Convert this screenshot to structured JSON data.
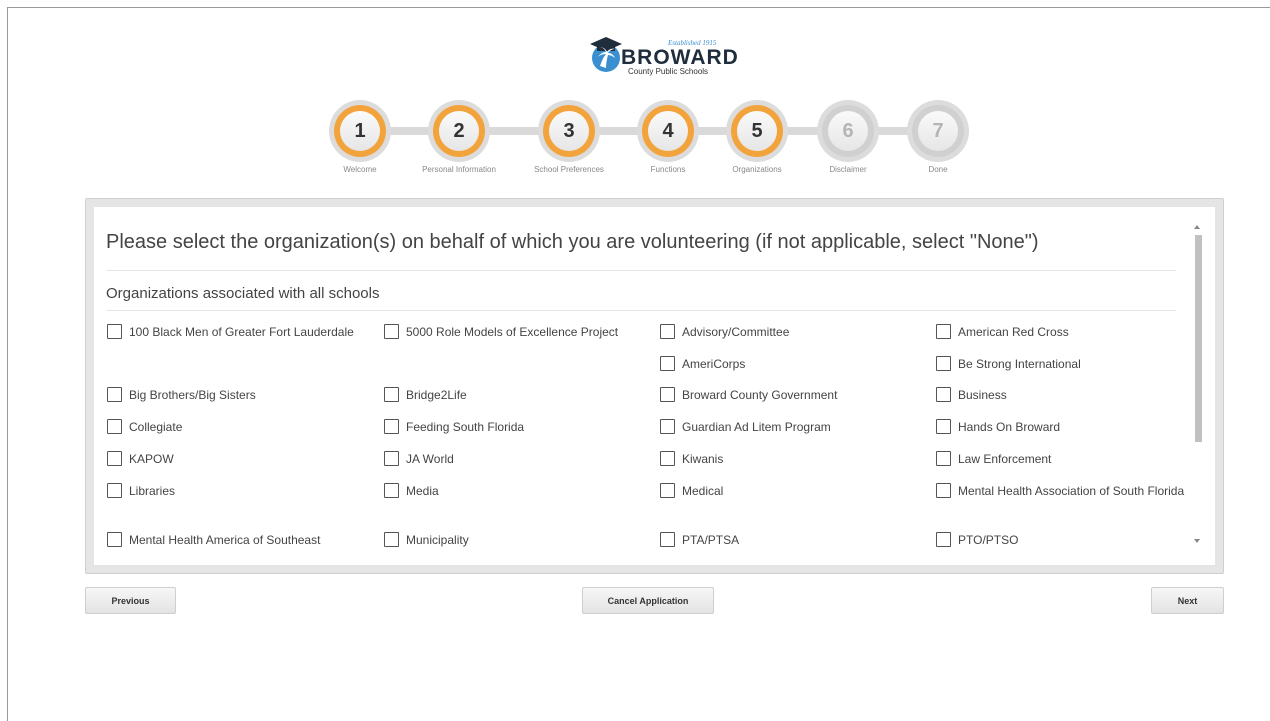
{
  "logo": {
    "established": "Established 1915",
    "name": "BROWARD",
    "subtitle": "County Public Schools"
  },
  "steps": [
    {
      "number": "1",
      "label": "Welcome",
      "state": "done"
    },
    {
      "number": "2",
      "label": "Personal Information",
      "state": "done"
    },
    {
      "number": "3",
      "label": "School Preferences",
      "state": "done"
    },
    {
      "number": "4",
      "label": "Functions",
      "state": "done"
    },
    {
      "number": "5",
      "label": "Organizations",
      "state": "current"
    },
    {
      "number": "6",
      "label": "Disclaimer",
      "state": "inactive"
    },
    {
      "number": "7",
      "label": "Done",
      "state": "inactive"
    }
  ],
  "colors": {
    "accent": "#f3a33c",
    "inactive": "#d0d0d0"
  },
  "panel": {
    "question": "Please select the organization(s) on behalf of which you are volunteering (if not applicable, select \"None\")",
    "section_title": "Organizations associated with all schools",
    "organizations": [
      "100 Black Men of Greater Fort Lauderdale",
      "5000 Role Models of Excellence Project",
      "Advisory/Committee",
      "American Red Cross",
      "AmeriCorps",
      "Be Strong International",
      "Big Brothers/Big Sisters",
      "Bridge2Life",
      "Broward County Government",
      "Business",
      "Collegiate",
      "Feeding South Florida",
      "Guardian Ad Litem Program",
      "Hands On Broward",
      "KAPOW",
      "JA World",
      "Kiwanis",
      "Law Enforcement",
      "Libraries",
      "Media",
      "Medical",
      "Mental Health Association of South Florida",
      "Mental Health America of Southeast",
      "Municipality",
      "PTA/PTSA",
      "PTO/PTSO"
    ]
  },
  "buttons": {
    "previous": "Previous",
    "cancel": "Cancel Application",
    "next": "Next"
  }
}
